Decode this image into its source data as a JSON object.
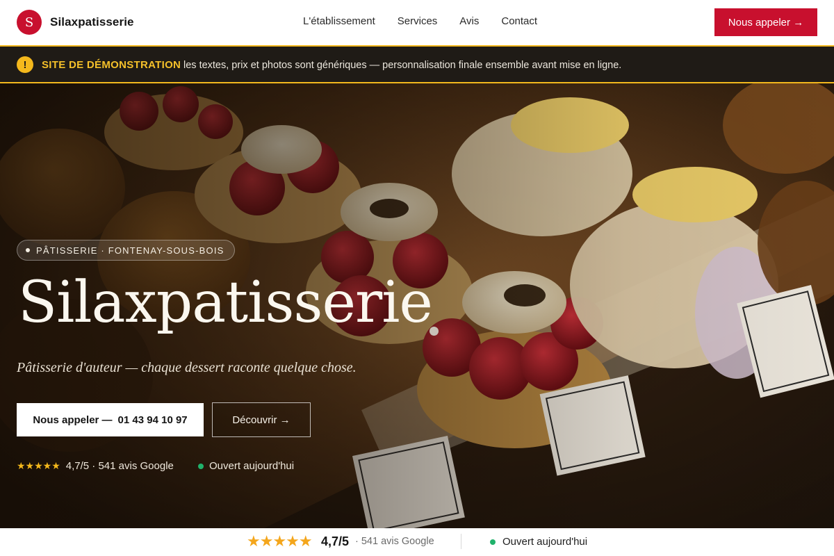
{
  "nav": {
    "logo_letter": "S",
    "brand": "Silaxpatisserie",
    "links": [
      "L'établissement",
      "Services",
      "Avis",
      "Contact"
    ],
    "cta": "Nous appeler →"
  },
  "banner": {
    "icon": "warning-icon",
    "title": "SITE DE DÉMONSTRATION",
    "text": "les textes, prix et photos sont génériques — personnalisation finale ensemble avant mise en ligne."
  },
  "hero": {
    "pill": "PÂTISSERIE · FONTENAY-SOUS-BOIS",
    "title": "Silaxpatisserie",
    "subtitle": "Pâtisserie d'auteur — chaque dessert raconte quelque chose.",
    "call_button": {
      "label": "Nous appeler —",
      "phone": "01 43 94 10 97"
    },
    "discover_button": "Découvrir →",
    "rating": {
      "stars": "★★★★★",
      "text": "4,7/5 · 541 avis Google"
    },
    "open_status": "Ouvert aujourd'hui"
  },
  "strip": {
    "stars": "★★★★★",
    "score": "4,7/5",
    "reviews": "· 541 avis Google",
    "open_status": "Ouvert aujourd'hui"
  },
  "colors": {
    "brand_red": "#c8102e",
    "banner_bg": "#1f1b16",
    "banner_accent": "#f3b81d",
    "open_green": "#20b26b",
    "star_gold": "#f4a61c"
  }
}
